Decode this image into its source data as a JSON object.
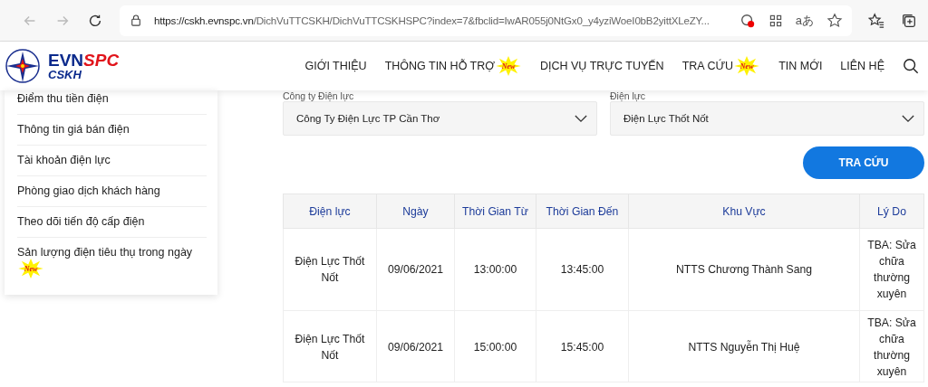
{
  "browser": {
    "url_host": "https://cskh.evnspc.vn",
    "url_path": "/DichVuTTCSKH/DichVuTTCSKHSPC?index=7&fbclid=IwAR055j0NtGx0_y4yziWoeI0bB2yittXLeZY...",
    "translate_glyph": "aあ"
  },
  "logo": {
    "brand": "EVN",
    "brand_accent": "SPC",
    "sub": "CSKH"
  },
  "nav": [
    {
      "label": "GIỚI THIỆU"
    },
    {
      "label": "THÔNG TIN HỖ TRỢ",
      "badge": "New"
    },
    {
      "label": "DỊCH VỤ TRỰC TUYẾN"
    },
    {
      "label": "TRA CỨU",
      "badge": "New"
    },
    {
      "label": "TIN MỚI"
    },
    {
      "label": "LIÊN HỆ"
    }
  ],
  "sidebar": {
    "items": [
      {
        "label": "Điểm thu tiền điện"
      },
      {
        "label": "Thông tin giá bán điện"
      },
      {
        "label": "Tài khoản điện lực"
      },
      {
        "label": "Phòng giao dịch khách hàng"
      },
      {
        "label": "Theo dõi tiến độ cấp điện"
      },
      {
        "label": "Sản lượng điện tiêu thụ trong ngày",
        "badge": "New"
      }
    ]
  },
  "filters": [
    {
      "label": "Công ty Điện lực",
      "value": "Công Ty Điện Lực TP Cần Thơ"
    },
    {
      "label": "Điện lực",
      "value": "Điện Lực Thốt Nốt"
    }
  ],
  "search_button": "TRA CỨU",
  "table": {
    "columns": [
      "Điện lực",
      "Ngày",
      "Thời Gian Từ",
      "Thời Gian Đến",
      "Khu Vực",
      "Lý Do"
    ],
    "rows": [
      [
        "Điện Lực Thốt Nốt",
        "09/06/2021",
        "13:00:00",
        "13:45:00",
        "NTTS Chương Thành Sang",
        "TBA: Sửa chữa thường xuyên"
      ],
      [
        "Điện Lực Thốt Nốt",
        "09/06/2021",
        "15:00:00",
        "15:45:00",
        "NTTS Nguyễn Thị Huệ",
        "TBA: Sửa chữa thường xuyên"
      ]
    ]
  }
}
